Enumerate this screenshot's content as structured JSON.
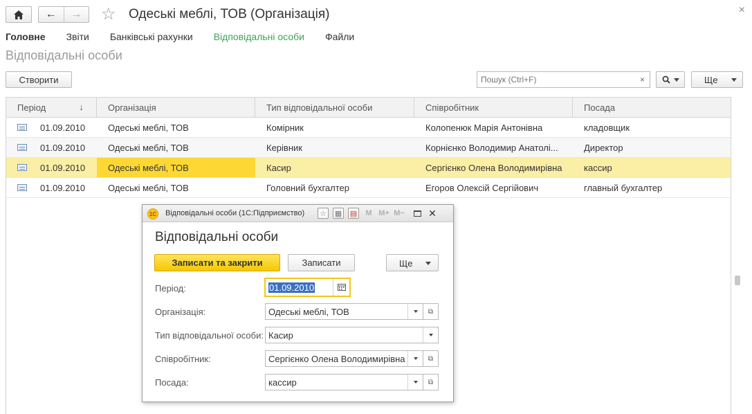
{
  "header": {
    "title": "Одеські меблі, ТОВ (Організація)"
  },
  "tabs": [
    {
      "label": "Головне"
    },
    {
      "label": "Звіти"
    },
    {
      "label": "Банківські рахунки"
    },
    {
      "label": "Відповідальні особи"
    },
    {
      "label": "Файли"
    }
  ],
  "page": {
    "subtitle": "Відповідальні особи"
  },
  "toolbar": {
    "create_label": "Створити",
    "search_placeholder": "Пошук (Ctrl+F)",
    "clear_symbol": "×",
    "more_label": "Ще"
  },
  "table": {
    "columns": [
      "Період",
      "Організація",
      "Тип відповідальної особи",
      "Співробітник",
      "Посада"
    ],
    "sort_indicator": "↓",
    "rows": [
      {
        "period": "01.09.2010",
        "org": "Одеські меблі, ТОВ",
        "type": "Комірник",
        "employee": "Колопенюк Марія Антонівна",
        "position": "кладовщик"
      },
      {
        "period": "01.09.2010",
        "org": "Одеські меблі, ТОВ",
        "type": "Керівник",
        "employee": "Корнієнко Володимир Анатолі...",
        "position": "Директор"
      },
      {
        "period": "01.09.2010",
        "org": "Одеські меблі, ТОВ",
        "type": "Касир",
        "employee": "Сергієнко Олена Володимирівна",
        "position": "кассир"
      },
      {
        "period": "01.09.2010",
        "org": "Одеські меблі, ТОВ",
        "type": "Головний бухгалтер",
        "employee": "Егоров Олексій Сергійович",
        "position": "главный бухгалтер"
      }
    ]
  },
  "dialog": {
    "window_title": "Відповідальні особи  (1С:Підприємство)",
    "logo_text": "1С",
    "tools": [
      "M",
      "M+",
      "M−"
    ],
    "heading": "Відповідальні особи",
    "save_close_label": "Записати та закрити",
    "save_label": "Записати",
    "more_label": "Ще",
    "fields": {
      "period_label": "Період:",
      "period_value": "01.09.2010",
      "org_label": "Організація:",
      "org_value": "Одеські меблі, ТОВ",
      "type_label": "Тип відповідальної особи:",
      "type_value": "Касир",
      "employee_label": "Співробітник:",
      "employee_value": "Сергієнко Олена Володимирівна",
      "position_label": "Посада:",
      "position_value": "кассир"
    }
  }
}
